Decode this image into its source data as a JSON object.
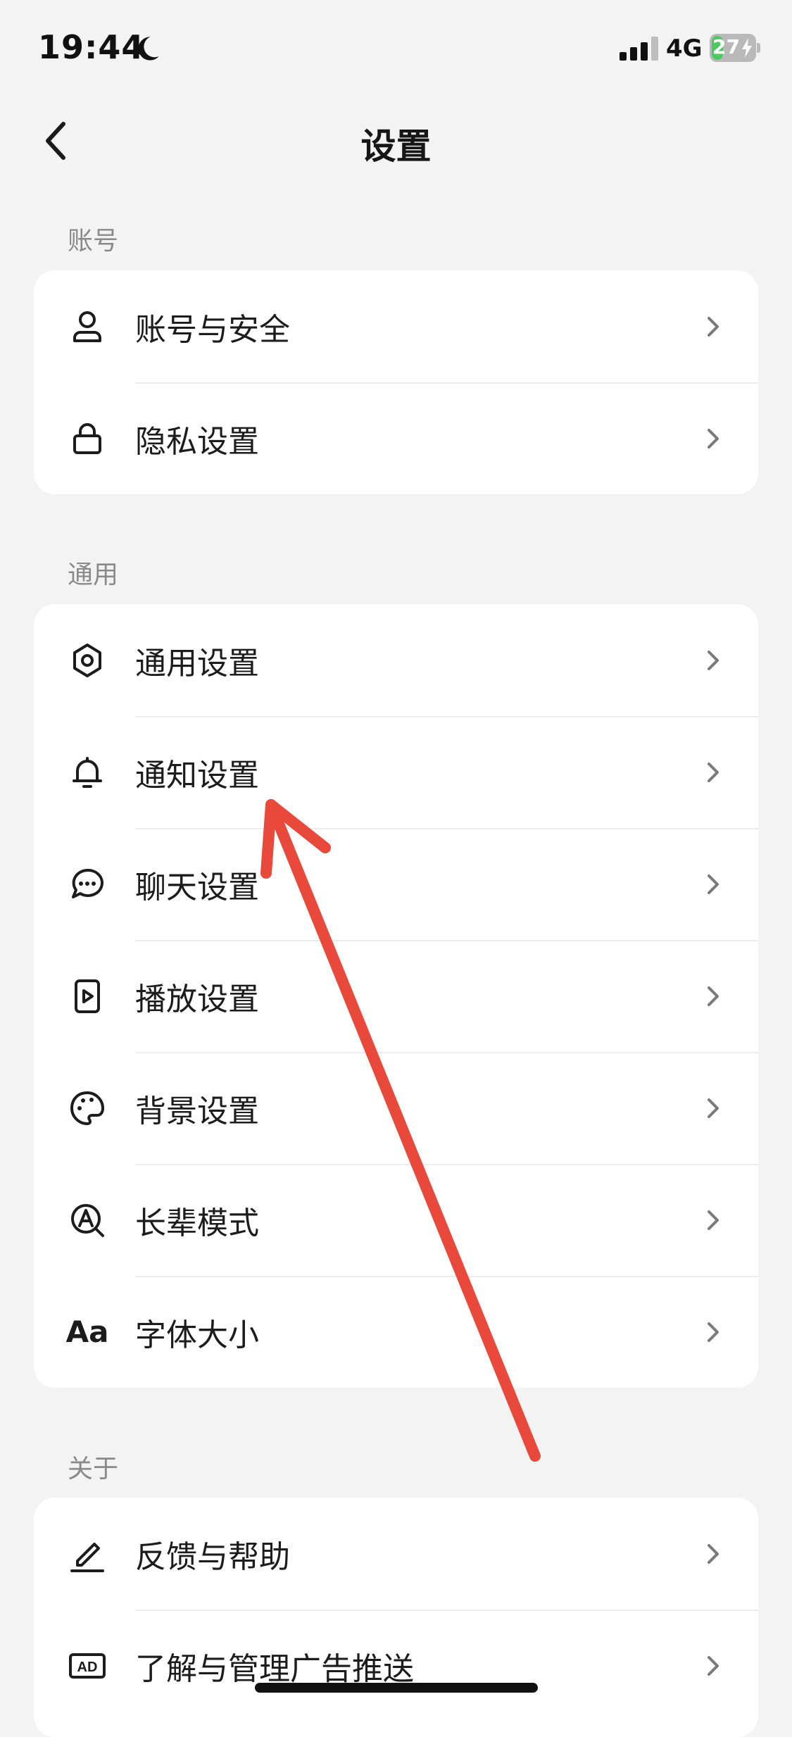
{
  "status_bar": {
    "time": "19:44",
    "network": "4G",
    "battery_level": "27",
    "battery_fraction": 0.27
  },
  "nav": {
    "title": "设置",
    "back_icon": "chevron-left-icon"
  },
  "sections": [
    {
      "header": "账号",
      "items": [
        {
          "label": "账号与安全",
          "icon": "user-icon"
        },
        {
          "label": "隐私设置",
          "icon": "lock-icon"
        }
      ]
    },
    {
      "header": "通用",
      "items": [
        {
          "label": "通用设置",
          "icon": "gear-icon"
        },
        {
          "label": "通知设置",
          "icon": "bell-icon"
        },
        {
          "label": "聊天设置",
          "icon": "chat-bubble-icon"
        },
        {
          "label": "播放设置",
          "icon": "play-icon"
        },
        {
          "label": "背景设置",
          "icon": "palette-icon"
        },
        {
          "label": "长辈模式",
          "icon": "elder-mode-icon"
        },
        {
          "label": "字体大小",
          "icon": "font-size-icon",
          "icon_text": "Aa"
        }
      ]
    },
    {
      "header": "关于",
      "items": [
        {
          "label": "反馈与帮助",
          "icon": "pencil-icon"
        },
        {
          "label": "了解与管理广告推送",
          "icon": "ad-icon",
          "icon_text": "AD"
        }
      ]
    }
  ],
  "colors": {
    "background": "#f3f3f3",
    "card": "#ffffff",
    "section_header": "#8a8a8a",
    "annotation_arrow": "#e8493a",
    "battery_fill": "#4cc95e"
  }
}
